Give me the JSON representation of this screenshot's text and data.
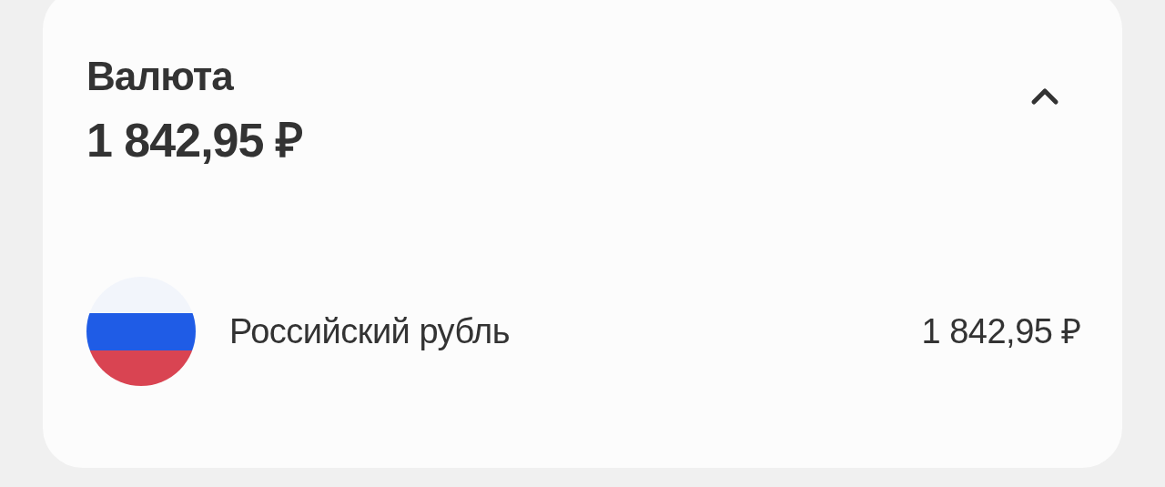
{
  "card": {
    "title": "Валюта",
    "total": "1 842,95 ₽",
    "expanded": true
  },
  "currencies": [
    {
      "name": "Российский рубль",
      "amount": "1 842,95 ₽"
    }
  ]
}
